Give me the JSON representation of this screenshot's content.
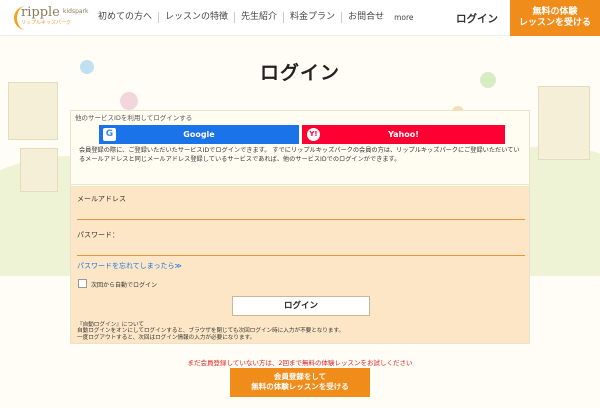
{
  "header": {
    "logo_main": "ripple",
    "logo_sub": "kidspark",
    "logo_kana": "リップルキッズパーク",
    "nav": [
      "初めての方へ",
      "レッスンの特徴",
      "先生紹介",
      "料金プラン",
      "お問合せ"
    ],
    "more": "more",
    "login": "ログイン",
    "trial_line1": "無料の体験",
    "trial_line2": "レッスンを受ける"
  },
  "page": {
    "title": "ログイン"
  },
  "social": {
    "heading": "他のサービスIDを利用してログインする",
    "google_label": "Google",
    "google_icon": "G",
    "yahoo_label": "Yahoo!",
    "yahoo_icon": "Y!",
    "note": "会員登録の際に、ご登録いただいたサービスIDでログインできます。 すでにリップルキッズパークの会員の方は、リップルキッズパークにご登録いただいているメールアドレスと同じメールアドレス登録しているサービスであれば、他のサービスIDでのログインができます。"
  },
  "form": {
    "email_label": "メールアドレス",
    "email_value": "",
    "password_label": "パスワード：",
    "password_value": "",
    "forgot": "パスワードを忘れてしまったら≫",
    "auto_login_label": "次回から自動でログイン",
    "auto_login_checked": false,
    "submit": "ログイン",
    "auto_note_1": "『自動ログイン』について",
    "auto_note_2": "自動ログインをオンにしてログインすると、ブラウザを閉じても次回ログイン時に入力が不要となります。",
    "auto_note_3": "一度ログアウトすると、次回はログイン情報の入力が必要になります。"
  },
  "trial": {
    "note": "まだ会員登録していない方は、2回まで無料の体験レッスンをお試しください",
    "line1": "会員登録をして",
    "line2": "無料の体験レッスンを受ける"
  },
  "colors": {
    "accent": "#f08c1a",
    "google": "#1a73e8",
    "yahoo": "#ff0033",
    "form_bg": "#fde6c6",
    "alert": "#e02020"
  }
}
